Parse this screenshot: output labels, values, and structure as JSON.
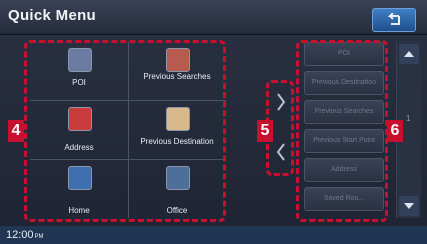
{
  "header": {
    "title": "Quick Menu",
    "back_icon": "back-arrow-icon"
  },
  "grid": {
    "items": [
      {
        "label": "POI",
        "icon": "poi-icon",
        "color": "#6a7aa0"
      },
      {
        "label": "Previous Searches",
        "icon": "previous-searches-icon",
        "color": "#b75a4f"
      },
      {
        "label": "Address",
        "icon": "address-icon",
        "color": "#c93b3b"
      },
      {
        "label": "Previous Destination",
        "icon": "previous-destination-icon",
        "color": "#d7b98b"
      },
      {
        "label": "Home",
        "icon": "home-icon",
        "color": "#3d6fae"
      },
      {
        "label": "Office",
        "icon": "office-icon",
        "color": "#4d6f9a"
      }
    ]
  },
  "callouts": {
    "left": "4",
    "middle": "5",
    "right": "6"
  },
  "list": {
    "items": [
      "POI",
      "Previous Destination",
      "Previous Searches",
      "Previous Start Point",
      "Address",
      "Saved Rou..."
    ]
  },
  "scroll": {
    "page_indicator": "1"
  },
  "status": {
    "time": "12:00",
    "ampm": "PM"
  }
}
